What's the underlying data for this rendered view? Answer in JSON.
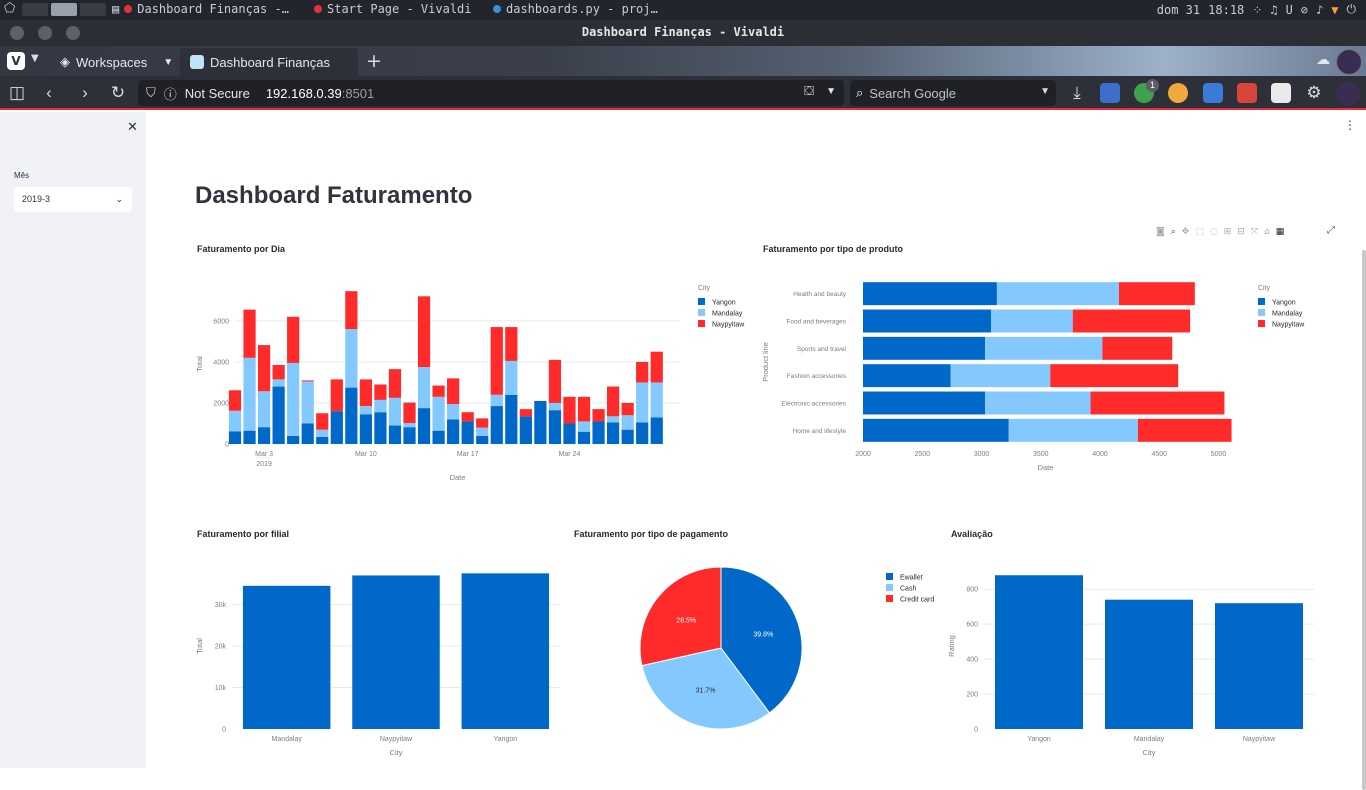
{
  "os": {
    "tasks": [
      {
        "label": "Dashboard Finanças -…",
        "color": "#e0333a"
      },
      {
        "label": "Start Page - Vivaldi",
        "color": "#e0333a"
      },
      {
        "label": "dashboards.py - proj…",
        "color": "#3b8fd8"
      }
    ],
    "date": "dom 31",
    "time": "18:18"
  },
  "browser": {
    "window_title": "Dashboard Finanças - Vivaldi",
    "workspaces_label": "Workspaces",
    "active_tab": "Dashboard Finanças",
    "security_label": "Not Secure",
    "url_host": "192.168.0.39",
    "url_port": ":8501",
    "search_placeholder": "Search Google",
    "notification_count": "1",
    "accent": "#e0333a"
  },
  "sidebar": {
    "month_label": "Mês",
    "month_value": "2019-3"
  },
  "page": {
    "title": "Dashboard Faturamento"
  },
  "colors": {
    "yangon": "#0068c9",
    "mandalay": "#83c9ff",
    "naypyitaw": "#ff2b2b"
  },
  "chart_data": [
    {
      "id": "daily",
      "type": "bar",
      "stacked": true,
      "title": "Faturamento por Dia",
      "xlabel": "Date",
      "ylabel": "Total",
      "x_ticks": [
        "Mar 3",
        "Mar 10",
        "Mar 17",
        "Mar 24"
      ],
      "x_tick_sub": "2019",
      "y_ticks": [
        "0",
        "2000",
        "4000",
        "6000"
      ],
      "ylim": [
        0,
        7800
      ],
      "legend_title": "City",
      "days": [
        1,
        2,
        3,
        4,
        5,
        6,
        7,
        8,
        9,
        10,
        11,
        12,
        13,
        14,
        15,
        16,
        17,
        18,
        19,
        20,
        21,
        22,
        23,
        24,
        25,
        26,
        27,
        28,
        29,
        30,
        31
      ],
      "series": [
        {
          "name": "Yangon",
          "values": [
            620,
            650,
            820,
            2800,
            400,
            1000,
            350,
            1600,
            2750,
            1450,
            1550,
            900,
            820,
            1750,
            650,
            1200,
            1100,
            400,
            1850,
            2400,
            1350,
            2100,
            1650,
            1000,
            600,
            1100,
            1050,
            700,
            1050,
            1300
          ]
        },
        {
          "name": "Mandalay",
          "values": [
            1000,
            3550,
            1750,
            350,
            3550,
            2050,
            350,
            0,
            2850,
            400,
            600,
            1350,
            200,
            2000,
            1650,
            750,
            0,
            400,
            550,
            1650,
            0,
            0,
            350,
            0,
            500,
            0,
            300,
            700,
            1950,
            1700
          ]
        },
        {
          "name": "Naypyitaw",
          "values": [
            1000,
            2350,
            2250,
            700,
            2250,
            50,
            800,
            1550,
            1850,
            1300,
            750,
            1400,
            1000,
            3450,
            550,
            1250,
            450,
            450,
            3300,
            1650,
            350,
            0,
            2100,
            1300,
            1200,
            600,
            1450,
            600,
            1000,
            1500
          ]
        }
      ]
    },
    {
      "id": "product",
      "type": "bar",
      "orientation": "horizontal",
      "stacked": true,
      "title": "Faturamento por tipo de produto",
      "xlabel": "Date",
      "ylabel": "Product line",
      "x_ticks": [
        "2000",
        "2500",
        "3000",
        "3500",
        "4000",
        "4500",
        "5000"
      ],
      "xlim": [
        2000,
        5080
      ],
      "legend_title": "City",
      "categories": [
        "Health and beauty",
        "Food and beverages",
        "Sports and travel",
        "Fashion accessories",
        "Electronic accessories",
        "Home and lifestyle"
      ],
      "series": [
        {
          "name": "Yangon",
          "values": [
            1130,
            1080,
            1030,
            740,
            1030,
            1230
          ]
        },
        {
          "name": "Mandalay",
          "values": [
            1030,
            690,
            990,
            840,
            890,
            1090
          ]
        },
        {
          "name": "Naypyitaw",
          "values": [
            640,
            990,
            590,
            1080,
            1130,
            790
          ]
        }
      ]
    },
    {
      "id": "branch",
      "type": "bar",
      "title": "Faturamento por filial",
      "xlabel": "City",
      "ylabel": "Total",
      "categories": [
        "Mandalay",
        "Naypyitaw",
        "Yangon"
      ],
      "values": [
        34500,
        37000,
        37500
      ],
      "y_ticks": [
        "0",
        "10k",
        "20k",
        "30k"
      ],
      "ylim": [
        0,
        40000
      ]
    },
    {
      "id": "payment",
      "type": "pie",
      "title": "Faturamento por tipo de pagamento",
      "labels": [
        "Ewallet",
        "Cash",
        "Credit card"
      ],
      "values": [
        39.8,
        31.7,
        28.5
      ],
      "value_labels": [
        "39.8%",
        "31.7%",
        "28.5%"
      ]
    },
    {
      "id": "rating",
      "type": "bar",
      "title": "Avaliação",
      "xlabel": "City",
      "ylabel": "Rating",
      "categories": [
        "Yangon",
        "Mandalay",
        "Naypyitaw"
      ],
      "values": [
        880,
        740,
        720
      ],
      "y_ticks": [
        "0",
        "200",
        "400",
        "600",
        "800"
      ],
      "ylim": [
        0,
        950
      ]
    }
  ]
}
